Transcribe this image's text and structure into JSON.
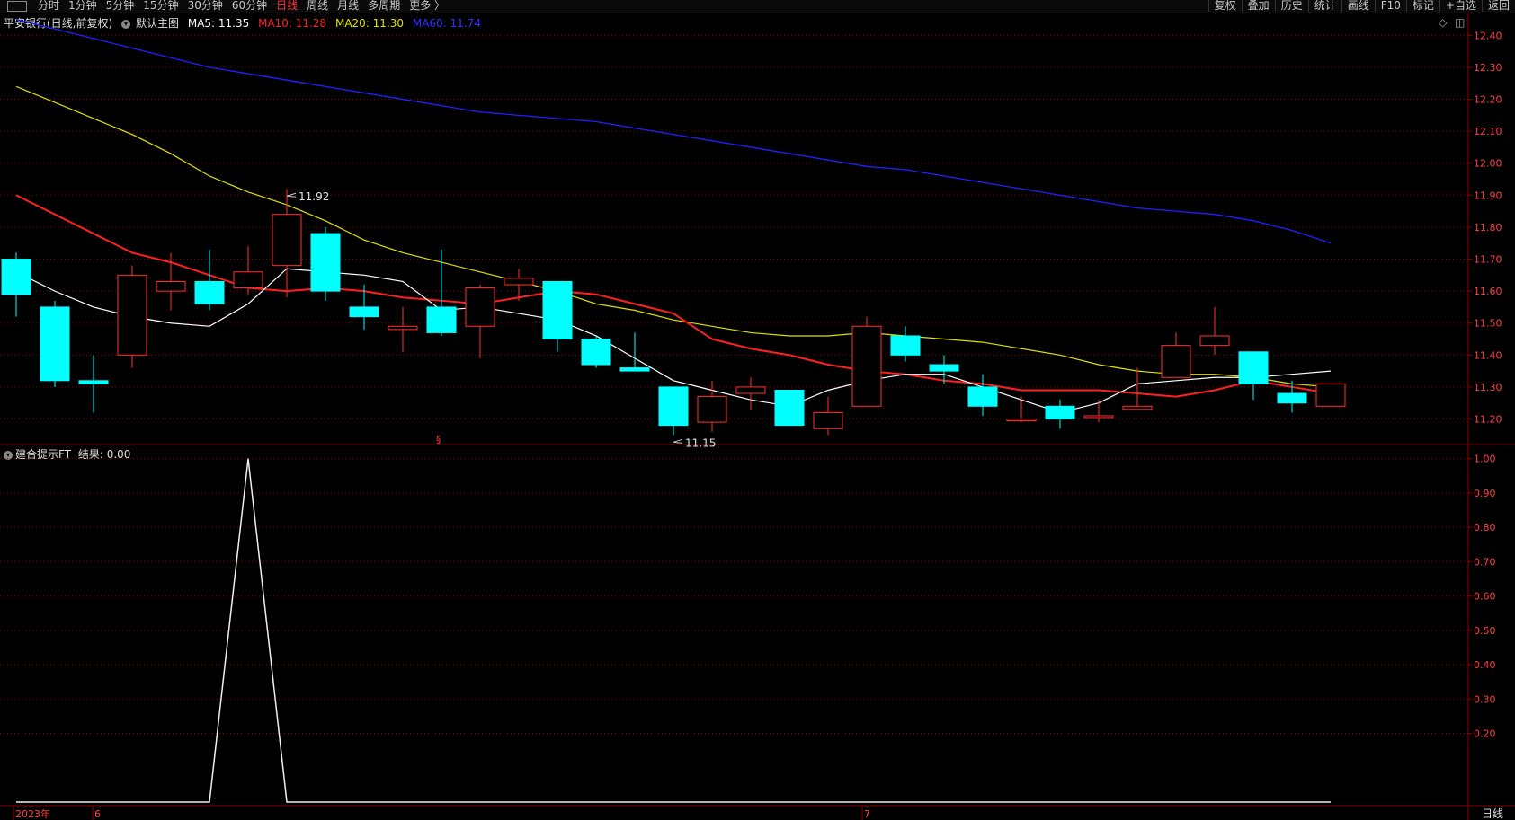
{
  "toolbar": {
    "periods": [
      "分时",
      "1分钟",
      "5分钟",
      "15分钟",
      "30分钟",
      "60分钟",
      "日线",
      "周线",
      "月线",
      "多周期",
      "更多 〉"
    ],
    "active_period": "日线",
    "right_items": [
      "复权",
      "叠加",
      "历史",
      "统计",
      "画线",
      "F10",
      "标记",
      "+自选",
      "返回"
    ]
  },
  "main_legend": {
    "title": "平安银行(日线,前复权)",
    "indicator": "默认主图",
    "ma5": "MA5: 11.35",
    "ma10": "MA10: 11.28",
    "ma20": "MA20: 11.30",
    "ma60": "MA60: 11.74"
  },
  "sub_legend": {
    "name": "建合提示FT",
    "result": "结果: 0.00"
  },
  "colors": {
    "up": "#ff3030",
    "down": "#00ffff",
    "ma5": "#ffffff",
    "ma10": "#ff2020",
    "ma20": "#e0e000",
    "ma60": "#2020ff",
    "grid": "#8b0000"
  },
  "chart_data": [
    {
      "type": "candlestick",
      "yticks": [
        "12.40",
        "12.30",
        "12.20",
        "12.10",
        "12.00",
        "11.90",
        "11.80",
        "11.70",
        "11.60",
        "11.50",
        "11.40",
        "11.30",
        "11.20"
      ],
      "ylim": [
        11.12,
        12.46
      ],
      "candles": [
        {
          "o": 11.7,
          "h": 11.72,
          "l": 11.52,
          "c": 11.59
        },
        {
          "o": 11.55,
          "h": 11.57,
          "l": 11.3,
          "c": 11.32
        },
        {
          "o": 11.32,
          "h": 11.4,
          "l": 11.22,
          "c": 11.31
        },
        {
          "o": 11.4,
          "h": 11.68,
          "l": 11.36,
          "c": 11.65
        },
        {
          "o": 11.6,
          "h": 11.72,
          "l": 11.54,
          "c": 11.63
        },
        {
          "o": 11.63,
          "h": 11.73,
          "l": 11.54,
          "c": 11.56
        },
        {
          "o": 11.61,
          "h": 11.74,
          "l": 11.59,
          "c": 11.66
        },
        {
          "o": 11.68,
          "h": 11.92,
          "l": 11.58,
          "c": 11.84
        },
        {
          "o": 11.78,
          "h": 11.8,
          "l": 11.57,
          "c": 11.6
        },
        {
          "o": 11.55,
          "h": 11.62,
          "l": 11.48,
          "c": 11.52
        },
        {
          "o": 11.48,
          "h": 11.55,
          "l": 11.41,
          "c": 11.49
        },
        {
          "o": 11.55,
          "h": 11.73,
          "l": 11.46,
          "c": 11.47
        },
        {
          "o": 11.49,
          "h": 11.62,
          "l": 11.39,
          "c": 11.61
        },
        {
          "o": 11.62,
          "h": 11.67,
          "l": 11.57,
          "c": 11.64
        },
        {
          "o": 11.63,
          "h": 11.63,
          "l": 11.41,
          "c": 11.45
        },
        {
          "o": 11.45,
          "h": 11.46,
          "l": 11.36,
          "c": 11.37
        },
        {
          "o": 11.36,
          "h": 11.47,
          "l": 11.35,
          "c": 11.35
        },
        {
          "o": 11.3,
          "h": 11.3,
          "l": 11.15,
          "c": 11.18
        },
        {
          "o": 11.19,
          "h": 11.32,
          "l": 11.16,
          "c": 11.27
        },
        {
          "o": 11.28,
          "h": 11.33,
          "l": 11.23,
          "c": 11.3
        },
        {
          "o": 11.29,
          "h": 11.29,
          "l": 11.18,
          "c": 11.18
        },
        {
          "o": 11.17,
          "h": 11.27,
          "l": 11.15,
          "c": 11.22
        },
        {
          "o": 11.24,
          "h": 11.52,
          "l": 11.24,
          "c": 11.49
        },
        {
          "o": 11.46,
          "h": 11.49,
          "l": 11.38,
          "c": 11.4
        },
        {
          "o": 11.37,
          "h": 11.4,
          "l": 11.31,
          "c": 11.35
        },
        {
          "o": 11.3,
          "h": 11.34,
          "l": 11.21,
          "c": 11.24
        },
        {
          "o": 11.2,
          "h": 11.27,
          "l": 11.19,
          "c": 11.2
        },
        {
          "o": 11.24,
          "h": 11.26,
          "l": 11.17,
          "c": 11.2
        },
        {
          "o": 11.21,
          "h": 11.26,
          "l": 11.19,
          "c": 11.21
        },
        {
          "o": 11.23,
          "h": 11.36,
          "l": 11.23,
          "c": 11.24
        },
        {
          "o": 11.33,
          "h": 11.47,
          "l": 11.33,
          "c": 11.43
        },
        {
          "o": 11.43,
          "h": 11.55,
          "l": 11.4,
          "c": 11.46
        },
        {
          "o": 11.41,
          "h": 11.41,
          "l": 11.26,
          "c": 11.31
        },
        {
          "o": 11.28,
          "h": 11.32,
          "l": 11.22,
          "c": 11.25
        },
        {
          "o": 11.24,
          "h": 11.31,
          "l": 11.24,
          "c": 11.31
        }
      ],
      "ma5": [
        11.66,
        11.6,
        11.55,
        11.52,
        11.5,
        11.49,
        11.56,
        11.67,
        11.66,
        11.65,
        11.63,
        11.54,
        11.55,
        11.53,
        11.51,
        11.46,
        11.39,
        11.32,
        11.29,
        11.26,
        11.24,
        11.29,
        11.32,
        11.34,
        11.34,
        11.3,
        11.26,
        11.22,
        11.25,
        11.31,
        11.32,
        11.33,
        11.33,
        11.34,
        11.35
      ],
      "ma10": [
        11.9,
        11.84,
        11.78,
        11.72,
        11.69,
        11.65,
        11.61,
        11.6,
        11.61,
        11.6,
        11.58,
        11.57,
        11.56,
        11.58,
        11.6,
        11.59,
        11.56,
        11.53,
        11.45,
        11.42,
        11.4,
        11.37,
        11.35,
        11.34,
        11.32,
        11.31,
        11.29,
        11.29,
        11.29,
        11.28,
        11.27,
        11.29,
        11.32,
        11.3,
        11.28
      ],
      "ma20": [
        12.24,
        12.19,
        12.14,
        12.09,
        12.03,
        11.96,
        11.91,
        11.87,
        11.82,
        11.76,
        11.72,
        11.69,
        11.66,
        11.63,
        11.6,
        11.56,
        11.54,
        11.51,
        11.49,
        11.47,
        11.46,
        11.46,
        11.47,
        11.46,
        11.45,
        11.44,
        11.42,
        11.4,
        11.37,
        11.35,
        11.34,
        11.34,
        11.33,
        11.31,
        11.3
      ],
      "ma60": [
        12.45,
        12.42,
        12.39,
        12.36,
        12.33,
        12.3,
        12.28,
        12.26,
        12.24,
        12.22,
        12.2,
        12.18,
        12.16,
        12.15,
        12.14,
        12.13,
        12.11,
        12.09,
        12.07,
        12.05,
        12.03,
        12.01,
        11.99,
        11.98,
        11.96,
        11.94,
        11.92,
        11.9,
        11.88,
        11.86,
        11.85,
        11.84,
        11.82,
        11.79,
        11.75
      ],
      "annotations": [
        {
          "label": "11.92",
          "index": 7
        },
        {
          "label": "11.15",
          "index": 17
        }
      ],
      "xlabels": [
        "2023年",
        "6",
        "7"
      ]
    },
    {
      "type": "line",
      "yticks": [
        "1.00",
        "0.90",
        "0.80",
        "0.70",
        "0.60",
        "0.50",
        "0.40",
        "0.30",
        "0.20"
      ],
      "ylim": [
        0,
        1.02
      ],
      "values": [
        0,
        0,
        0,
        0,
        0,
        0,
        1,
        0,
        0,
        0,
        0,
        0,
        0,
        0,
        0,
        0,
        0,
        0,
        0,
        0,
        0,
        0,
        0,
        0,
        0,
        0,
        0,
        0,
        0,
        0,
        0,
        0,
        0,
        0,
        0
      ]
    }
  ],
  "bottom_right_label": "日线"
}
